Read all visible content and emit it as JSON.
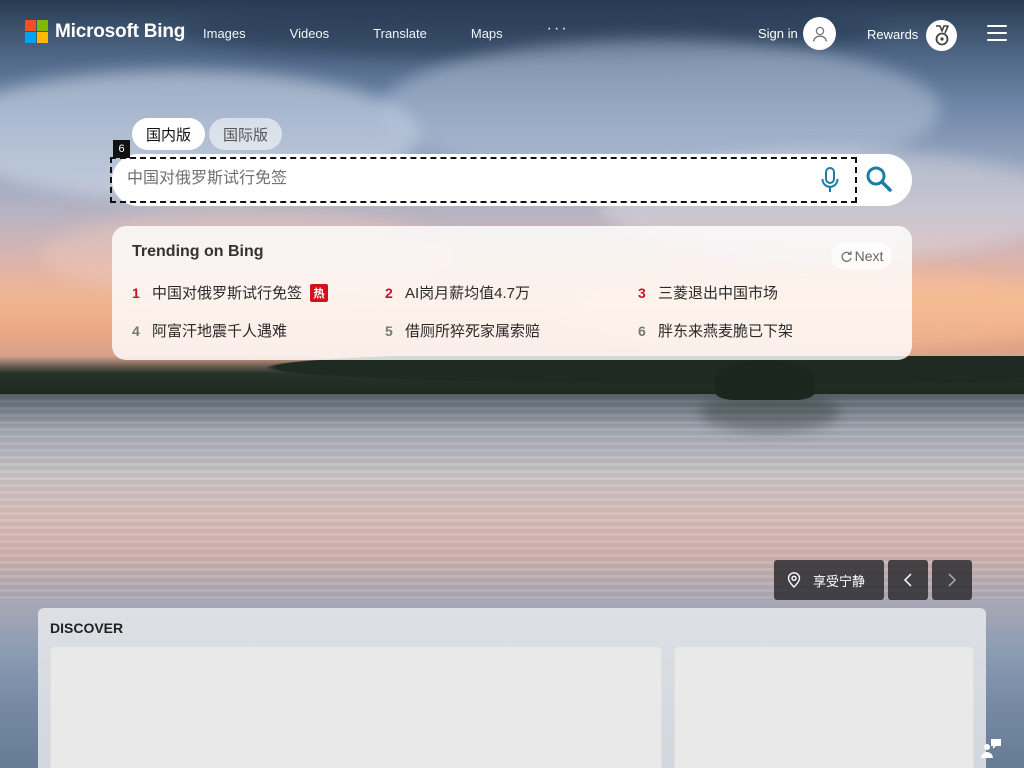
{
  "header": {
    "brand": "Microsoft Bing",
    "nav": [
      "Images",
      "Videos",
      "Translate",
      "Maps"
    ],
    "more_label": "···",
    "signin_label": "Sign in",
    "rewards_label": "Rewards"
  },
  "search": {
    "tabs": [
      {
        "label": "国内版",
        "active": true
      },
      {
        "label": "国际版",
        "active": false
      }
    ],
    "placeholder": "中国对俄罗斯试行免签",
    "focus_badge": "6"
  },
  "trending": {
    "title": "Trending on Bing",
    "next_label": "Next",
    "hot_badge": "热",
    "items": [
      {
        "rank": "1",
        "text": "中国对俄罗斯试行免签",
        "hot": true
      },
      {
        "rank": "2",
        "text": "AI岗月薪均值4.7万",
        "hot": false
      },
      {
        "rank": "3",
        "text": "三菱退出中国市场",
        "hot": false
      },
      {
        "rank": "4",
        "text": "阿富汗地震千人遇难",
        "hot": false
      },
      {
        "rank": "5",
        "text": "借厕所猝死家属索赔",
        "hot": false
      },
      {
        "rank": "6",
        "text": "胖东来燕麦脆已下架",
        "hot": false
      }
    ]
  },
  "image_info": {
    "location_label": "享受宁静"
  },
  "discover": {
    "title": "DISCOVER"
  },
  "colors": {
    "hot_red": "#c8102e",
    "accent_teal": "#1a7ea5"
  },
  "icons": [
    "microsoft-logo",
    "user-icon",
    "rewards-medal-icon",
    "menu-icon",
    "microphone-icon",
    "search-icon",
    "refresh-icon",
    "location-pin-icon",
    "chevron-left-icon",
    "chevron-right-icon",
    "feedback-icon"
  ]
}
